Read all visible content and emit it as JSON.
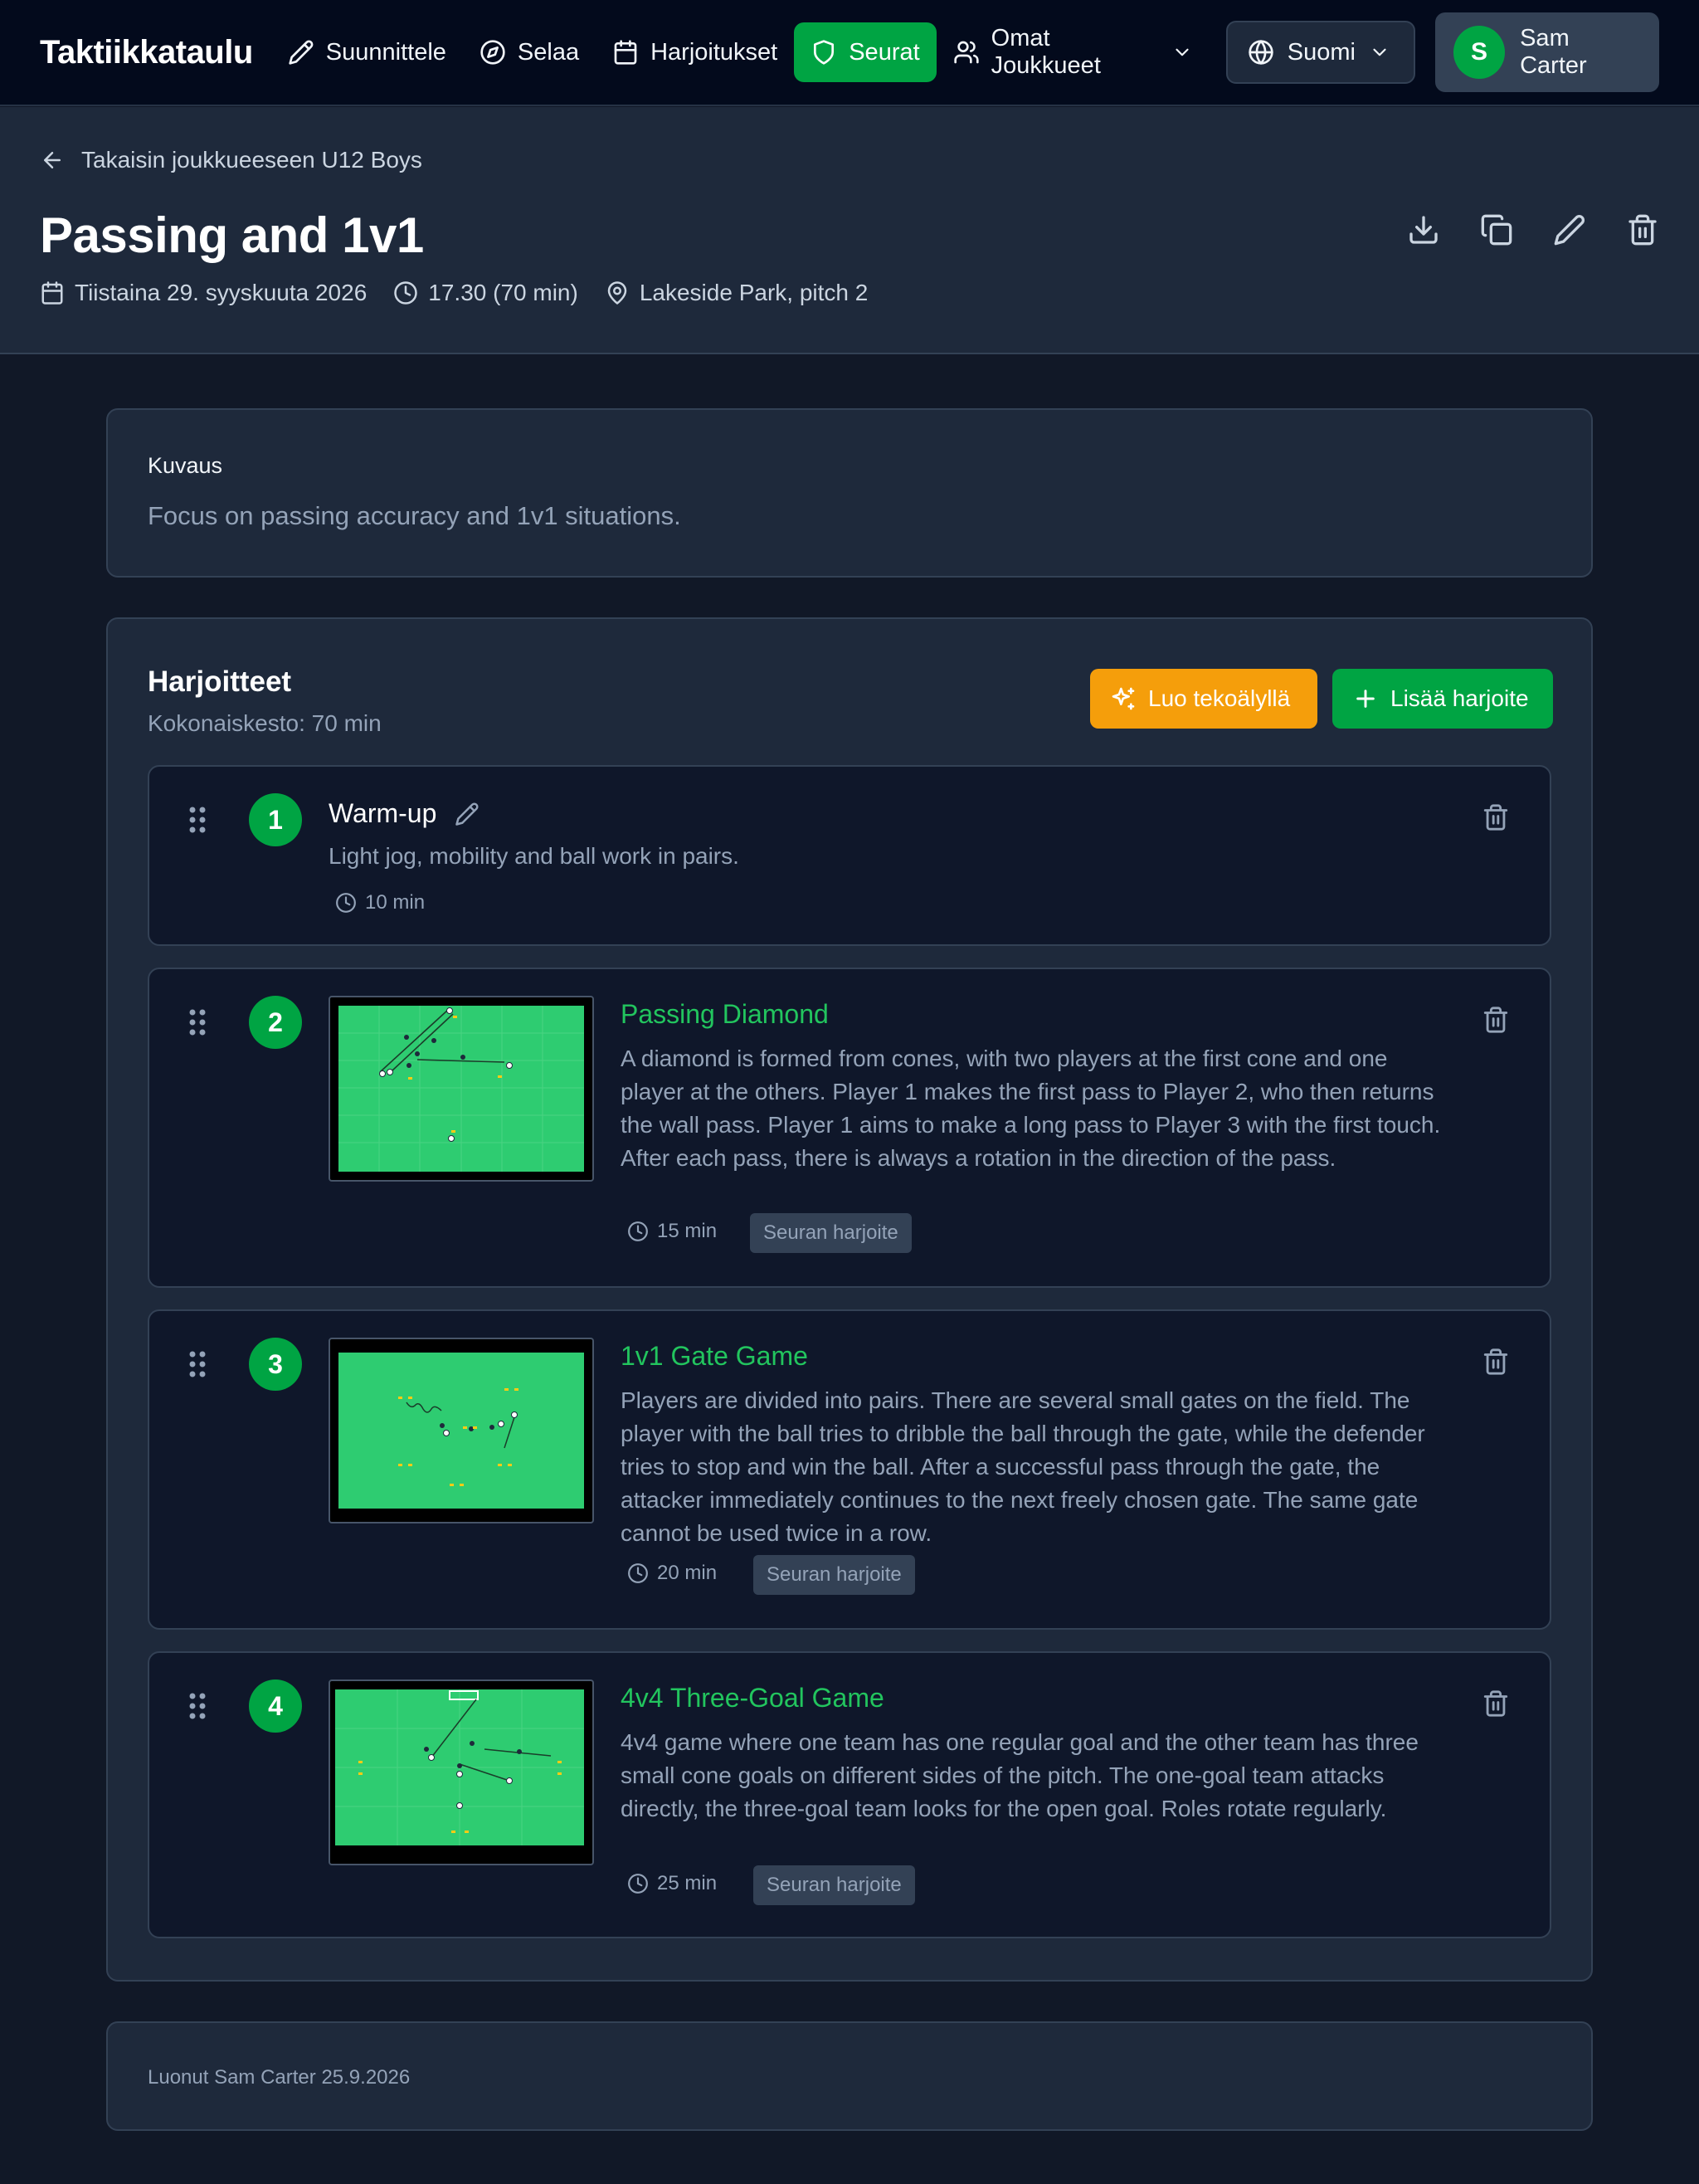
{
  "nav": {
    "brand": "Taktiikkataulu",
    "items": [
      {
        "label": "Suunnittele",
        "icon": "pencil-icon"
      },
      {
        "label": "Selaa",
        "icon": "compass-icon"
      },
      {
        "label": "Harjoitukset",
        "icon": "calendar-icon"
      },
      {
        "label": "Seurat",
        "icon": "shield-icon",
        "active": true
      },
      {
        "label": "Omat Joukkueet",
        "icon": "users-icon"
      }
    ],
    "language": "Suomi",
    "user": {
      "initial": "S",
      "name": "Sam Carter"
    }
  },
  "header": {
    "back_label": "Takaisin joukkueeseen U12 Boys",
    "title": "Passing and 1v1",
    "date": "Tiistaina 29. syyskuuta 2026",
    "time": "17.30 (70 min)",
    "location": "Lakeside Park, pitch 2",
    "actions": [
      "download-icon",
      "duplicate-icon",
      "edit-icon",
      "trash-icon"
    ]
  },
  "description": {
    "label": "Kuvaus",
    "text": "Focus on passing accuracy and 1v1 situations."
  },
  "exercises": {
    "title": "Harjoitteet",
    "total": "Kokonaiskesto: 70 min",
    "ai_button": "Luo tekoälyllä",
    "add_button": "Lisää harjoite",
    "items": [
      {
        "number": "1",
        "name": "Warm-up",
        "description": "Light jog, mobility and ball work in pairs.",
        "duration": "10 min"
      },
      {
        "number": "2",
        "name": "Passing Diamond",
        "description": "A diamond is formed from cones, with two players at the first cone and one player at the others. Player 1 makes the first pass to Player 2, who then returns the wall pass. Player 1 aims to make a long pass to Player 3 with the first touch. After each pass, there is always a rotation in the direction of the pass.",
        "duration": "15 min",
        "tag": "Seuran harjoite"
      },
      {
        "number": "3",
        "name": "1v1 Gate Game",
        "description": "Players are divided into pairs. There are several small gates on the field. The player with the ball tries to dribble the ball through the gate, while the defender tries to stop and win the ball. After a successful pass through the gate, the attacker immediately continues to the next freely chosen gate. The same gate cannot be used twice in a row.",
        "duration": "20 min",
        "tag": "Seuran harjoite"
      },
      {
        "number": "4",
        "name": "4v4 Three-Goal Game",
        "description": "4v4 game where one team has one regular goal and the other team has three small cone goals on different sides of the pitch. The one-goal team attacks directly, the three-goal team looks for the open goal. Roles rotate regularly.",
        "duration": "25 min",
        "tag": "Seuran harjoite"
      }
    ]
  },
  "footer": {
    "created": "Luonut Sam Carter 25.9.2026"
  },
  "colors": {
    "background": "#111827",
    "card": "#1e293b",
    "item": "#0f172a",
    "accent_green": "#00a443",
    "title_green": "#22c55e",
    "ai_orange": "#f59e0b"
  }
}
